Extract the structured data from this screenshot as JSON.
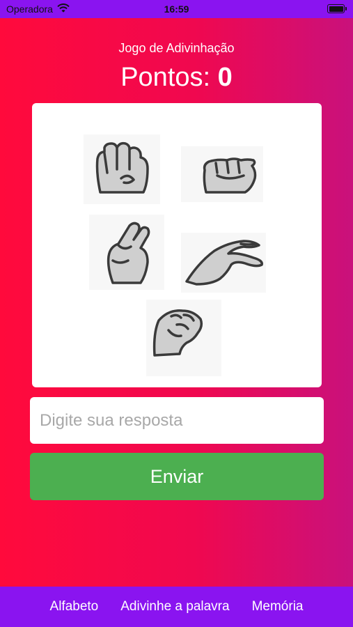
{
  "status_bar": {
    "carrier": "Operadora",
    "time": "16:59",
    "icons": [
      "wifi-icon",
      "battery-icon"
    ]
  },
  "game": {
    "title": "Jogo de Adivinhação",
    "score_label": "Pontos:",
    "score_value": "0",
    "image": {
      "description_icons": [
        "hand-sign-letter-icon"
      ],
      "sign_count": 5
    }
  },
  "answer": {
    "placeholder": "Digite sua resposta",
    "value": ""
  },
  "submit": {
    "label": "Enviar"
  },
  "tabs": [
    {
      "label": "Alfabeto"
    },
    {
      "label": "Adivinhe a palavra"
    },
    {
      "label": "Memória"
    }
  ],
  "colors": {
    "background_gradient_start": "#ff0a3c",
    "background_gradient_end": "#c9117c",
    "bar_purple": "#8a14f0",
    "submit_green": "#4caf50",
    "hand_fill": "#cfcfcf",
    "hand_outline": "#3a3a3a"
  }
}
